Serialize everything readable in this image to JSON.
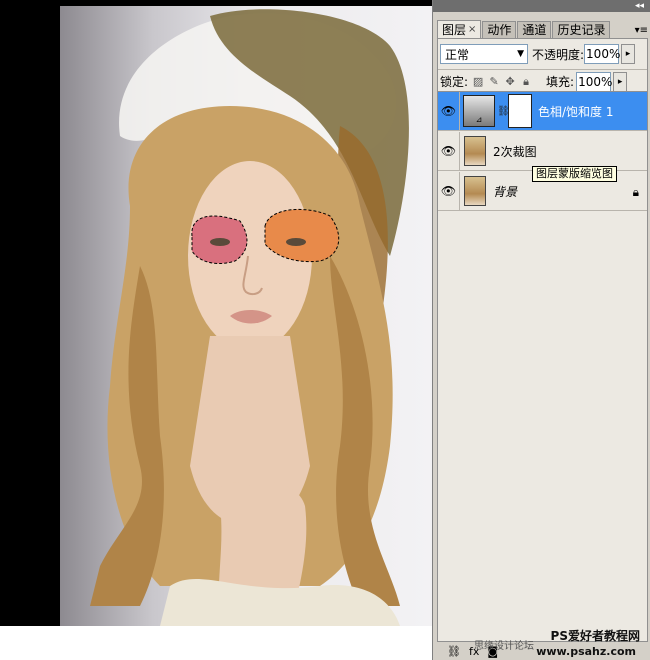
{
  "panel": {
    "tabs": [
      {
        "label": "图层",
        "active": true,
        "closable": true
      },
      {
        "label": "动作",
        "active": false
      },
      {
        "label": "通道",
        "active": false
      },
      {
        "label": "历史记录",
        "active": false
      }
    ],
    "blend_mode": "正常",
    "opacity_label": "不透明度:",
    "opacity_value": "100%",
    "lock_label": "锁定:",
    "fill_label": "填充:",
    "fill_value": "100%",
    "layers": [
      {
        "name": "色相/饱和度 1",
        "type": "adjustment",
        "selected": true,
        "visible": true,
        "thumb_icon": "hue-saturation-icon",
        "has_mask": true
      },
      {
        "name": "2次裁图",
        "type": "pixel",
        "selected": false,
        "visible": true
      },
      {
        "name": "背景",
        "type": "background",
        "selected": false,
        "visible": true,
        "locked": true
      }
    ],
    "tooltip": "图层蒙版缩览图"
  },
  "watermark": {
    "title": "PS爱好者教程网",
    "url": "www.psahz.com",
    "forum": "思缘设计论坛"
  },
  "colors": {
    "selection": "#3c8ef0",
    "panel_bg": "#d4d0c8",
    "list_bg": "#ece9e2"
  }
}
